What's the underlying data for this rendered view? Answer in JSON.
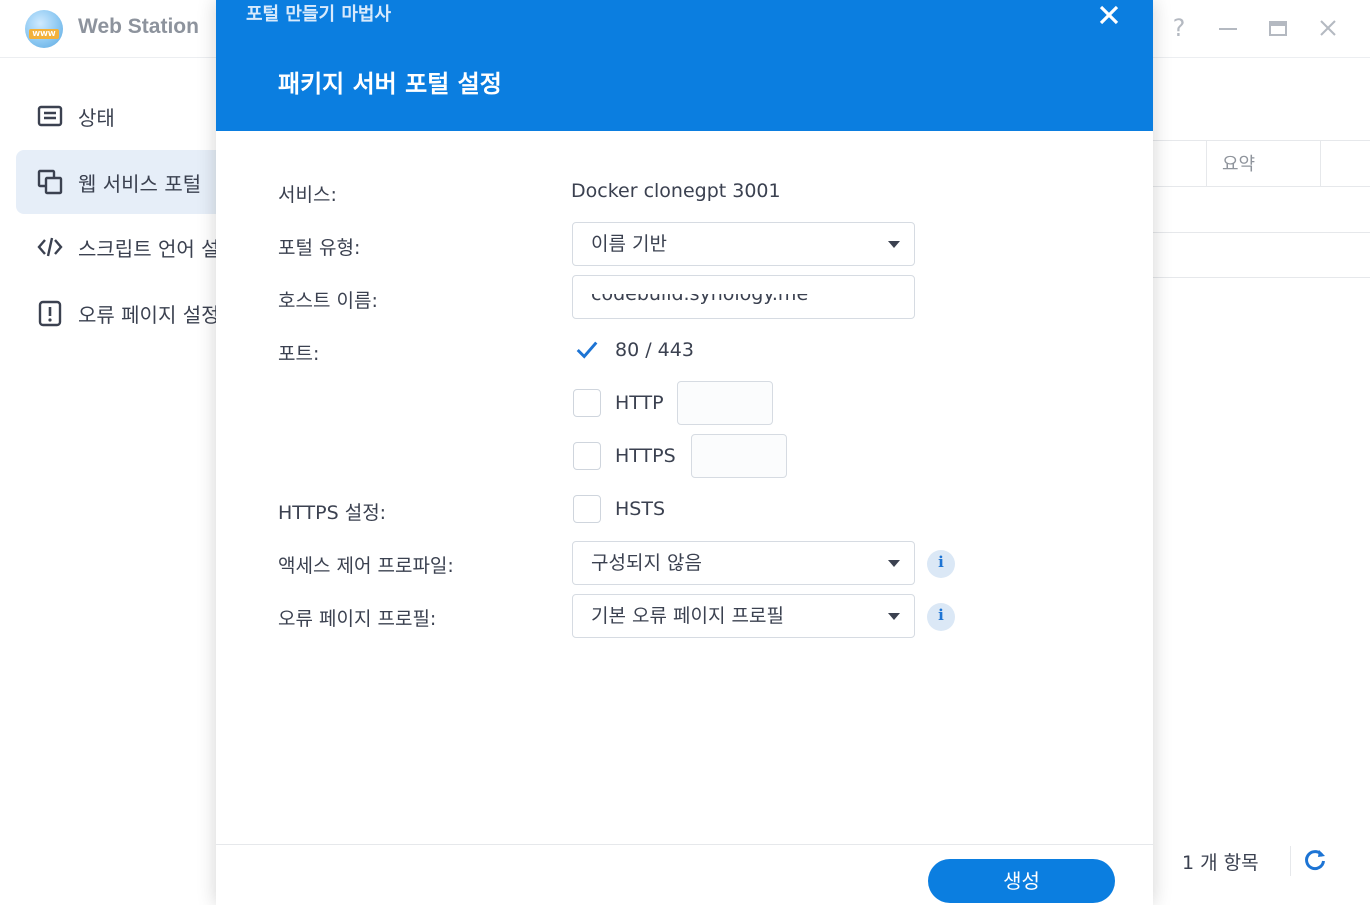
{
  "app": {
    "title": "Web Station",
    "logo_text": "WWW"
  },
  "window_controls": {
    "help": "?",
    "minimize": "minimize",
    "maximize": "maximize",
    "close": "close"
  },
  "sidebar": {
    "items": [
      {
        "label": "상태",
        "icon": "status-list-icon",
        "active": false
      },
      {
        "label": "웹 서비스 포털",
        "icon": "web-portal-icon",
        "active": true
      },
      {
        "label": "스크립트 언어 설정",
        "icon": "code-icon",
        "active": false
      },
      {
        "label": "오류 페이지 설정",
        "icon": "error-page-icon",
        "active": false
      }
    ]
  },
  "background_table": {
    "column_header": "요약",
    "footer_count": "1 개 항목"
  },
  "dialog": {
    "wizard_title": "포털 만들기 마법사",
    "step_title": "패키지 서버 포털 설정",
    "header_color": "#0b7ee0",
    "fields": {
      "service": {
        "label": "서비스:",
        "value": "Docker clonegpt 3001"
      },
      "portal_type": {
        "label": "포털 유형:",
        "value": "이름 기반"
      },
      "hostname": {
        "label": "호스트 이름:",
        "value": "codebuild.synology.me"
      },
      "port": {
        "label": "포트:",
        "options": [
          {
            "label": "80 / 443",
            "checked": true
          },
          {
            "label": "HTTP",
            "checked": false,
            "value": ""
          },
          {
            "label": "HTTPS",
            "checked": false,
            "value": ""
          }
        ]
      },
      "https_settings": {
        "label": "HTTPS 설정:",
        "option": {
          "label": "HSTS",
          "checked": false
        }
      },
      "access_control": {
        "label": "액세스 제어 프로파일:",
        "value": "구성되지 않음"
      },
      "error_page": {
        "label": "오류 페이지 프로필:",
        "value": "기본 오류 페이지 프로필"
      }
    },
    "info_glyph": "i",
    "create_button": "생성"
  }
}
